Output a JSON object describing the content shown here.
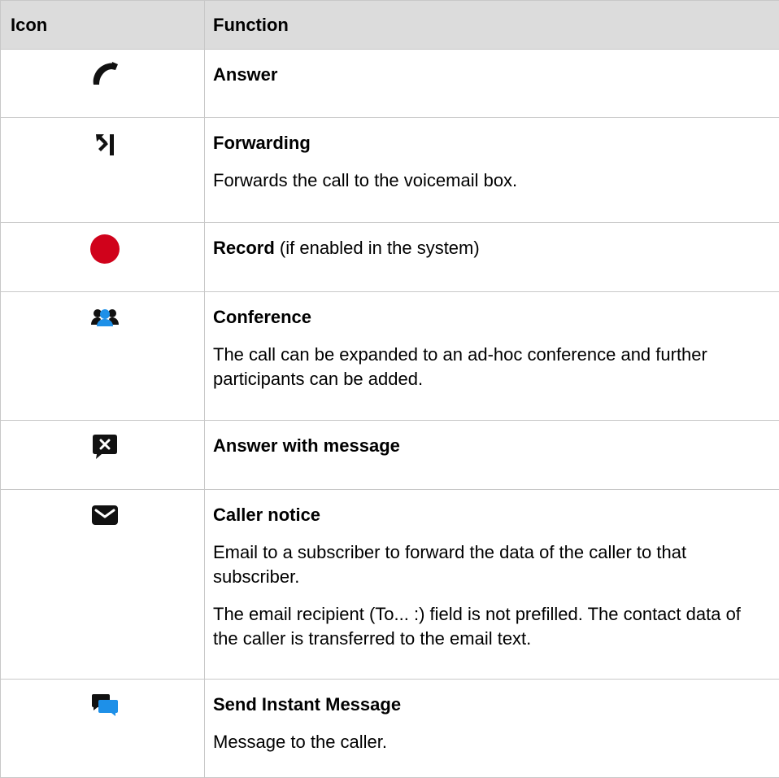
{
  "table": {
    "headers": {
      "icon": "Icon",
      "function": "Function"
    },
    "rows": [
      {
        "icon": "phone-handset-icon",
        "title": "Answer",
        "title_suffix": "",
        "descriptions": []
      },
      {
        "icon": "forward-arrow-icon",
        "title": "Forwarding",
        "title_suffix": "",
        "descriptions": [
          "Forwards the call to the voicemail box."
        ]
      },
      {
        "icon": "record-dot-icon",
        "title": "Record",
        "title_suffix": " (if enabled in the system)",
        "descriptions": []
      },
      {
        "icon": "conference-people-icon",
        "title": "Conference",
        "title_suffix": "",
        "descriptions": [
          "The call can be expanded to an ad-hoc conference and further participants can be added."
        ]
      },
      {
        "icon": "message-reject-icon",
        "title": "Answer with message",
        "title_suffix": "",
        "descriptions": []
      },
      {
        "icon": "envelope-icon",
        "title": "Caller notice",
        "title_suffix": "",
        "descriptions": [
          "Email to a subscriber to forward the data of the caller to that subscriber.",
          "The email recipient (To... :) field is not prefilled. The contact data of the caller is transferred to the email text."
        ]
      },
      {
        "icon": "chat-bubbles-icon",
        "title": "Send Instant Message",
        "title_suffix": "",
        "descriptions": [
          "Message to the caller."
        ]
      }
    ]
  },
  "colors": {
    "header_bg": "#dcdcdc",
    "border": "#c8c8c8",
    "record_red": "#d0021b",
    "conference_blue": "#1e90e8",
    "im_blue": "#1e90e8",
    "icon_dark": "#111111"
  }
}
